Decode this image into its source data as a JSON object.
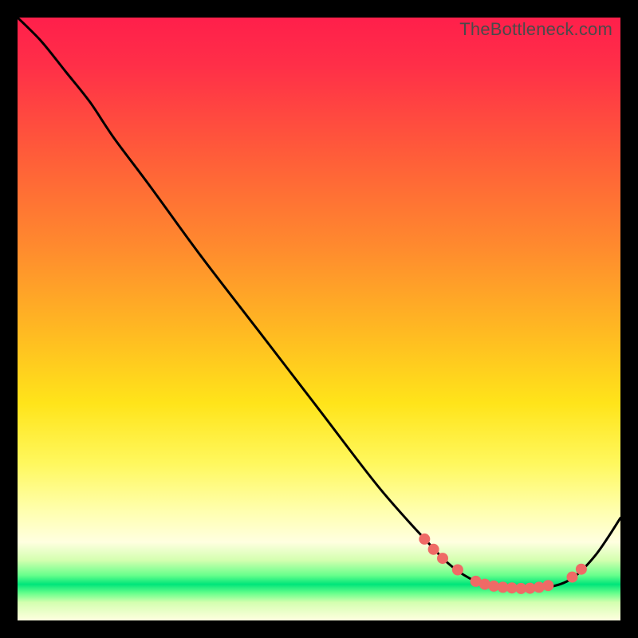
{
  "watermark": "TheBottleneck.com",
  "chart_data": {
    "type": "line",
    "title": "",
    "xlabel": "",
    "ylabel": "",
    "xlim": [
      0,
      100
    ],
    "ylim": [
      0,
      100
    ],
    "grid": false,
    "legend": false,
    "series": [
      {
        "name": "bottleneck-curve",
        "color": "#000000",
        "x": [
          0,
          4,
          8,
          12,
          16,
          22,
          30,
          40,
          50,
          60,
          68,
          72,
          76,
          80,
          84,
          88,
          92,
          96,
          100
        ],
        "y": [
          100,
          96,
          91,
          86,
          80,
          72,
          61,
          48,
          35,
          22,
          13,
          9,
          6.5,
          5.5,
          5.3,
          5.5,
          7,
          11,
          17
        ]
      }
    ],
    "markers": [
      {
        "x": 67.5,
        "y": 13.5
      },
      {
        "x": 69.0,
        "y": 11.8
      },
      {
        "x": 70.5,
        "y": 10.3
      },
      {
        "x": 73.0,
        "y": 8.4
      },
      {
        "x": 76.0,
        "y": 6.5
      },
      {
        "x": 77.5,
        "y": 6.0
      },
      {
        "x": 79.0,
        "y": 5.7
      },
      {
        "x": 80.5,
        "y": 5.5
      },
      {
        "x": 82.0,
        "y": 5.4
      },
      {
        "x": 83.5,
        "y": 5.3
      },
      {
        "x": 85.0,
        "y": 5.35
      },
      {
        "x": 86.5,
        "y": 5.5
      },
      {
        "x": 88.0,
        "y": 5.8
      },
      {
        "x": 92.0,
        "y": 7.2
      },
      {
        "x": 93.5,
        "y": 8.5
      }
    ],
    "marker_color": "#ef6a66",
    "marker_radius_px": 7
  }
}
